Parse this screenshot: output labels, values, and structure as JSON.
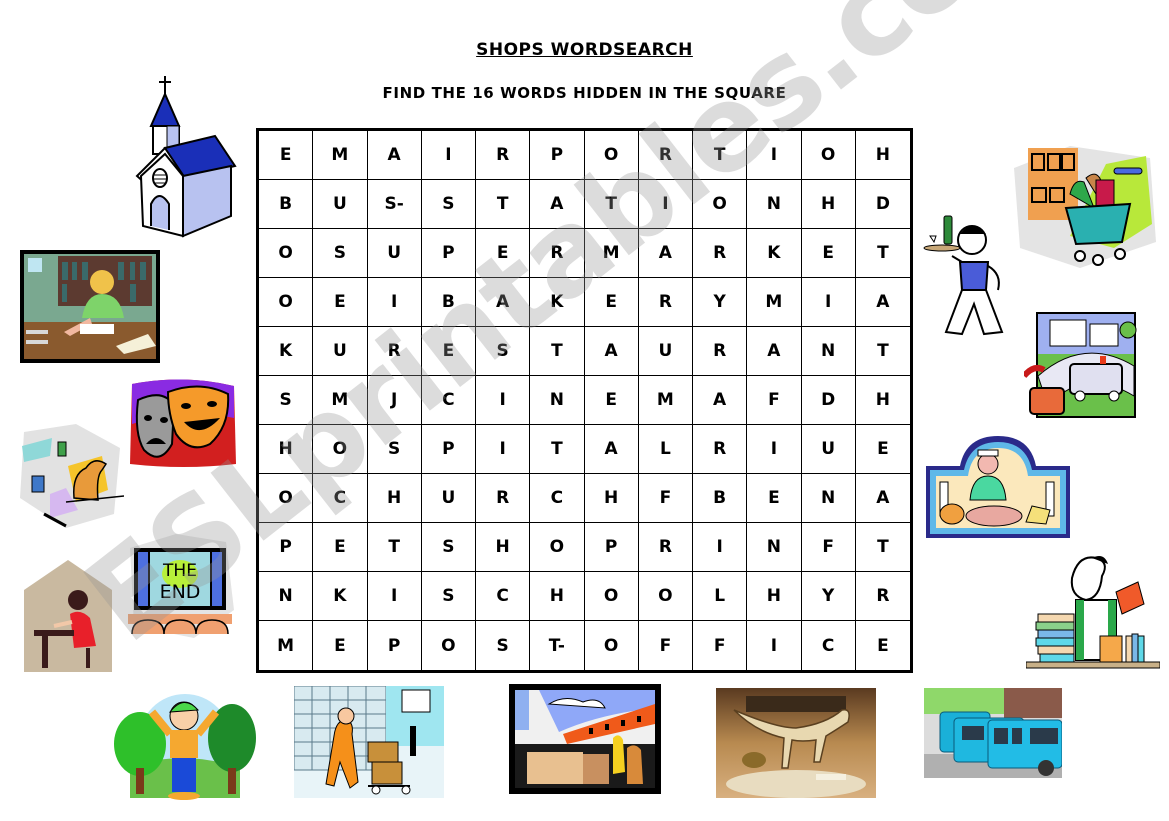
{
  "header": {
    "title": "SHOPS WORDSEARCH",
    "instructions": "FIND THE 16 WORDS HIDDEN IN THE SQUARE"
  },
  "grid": [
    [
      "E",
      "M",
      "A",
      "I",
      "R",
      "P",
      "O",
      "R",
      "T",
      "I",
      "O",
      "H"
    ],
    [
      "B",
      "U",
      "S-",
      "S",
      "T",
      "A",
      "T",
      "I",
      "O",
      "N",
      "H",
      "D"
    ],
    [
      "O",
      "S",
      "U",
      "P",
      "E",
      "R",
      "M",
      "A",
      "R",
      "K",
      "E",
      "T"
    ],
    [
      "O",
      "E",
      "I",
      "B",
      "A",
      "K",
      "E",
      "R",
      "Y",
      "M",
      "I",
      "A"
    ],
    [
      "K",
      "U",
      "R",
      "E",
      "S",
      "T",
      "A",
      "U",
      "R",
      "A",
      "N",
      "T"
    ],
    [
      "S",
      "M",
      "J",
      "C",
      "I",
      "N",
      "E",
      "M",
      "A",
      "F",
      "D",
      "H"
    ],
    [
      "H",
      "O",
      "S",
      "P",
      "I",
      "T",
      "A",
      "L",
      "R",
      "I",
      "U",
      "E"
    ],
    [
      "O",
      "C",
      "H",
      "U",
      "R",
      "C",
      "H",
      "F",
      "B",
      "E",
      "N",
      "A"
    ],
    [
      "P",
      "E",
      "T",
      "S",
      "H",
      "O",
      "P",
      "R",
      "I",
      "N",
      "F",
      "T"
    ],
    [
      "N",
      "K",
      "I",
      "S",
      "C",
      "H",
      "O",
      "O",
      "L",
      "H",
      "Y",
      "R"
    ],
    [
      "M",
      "E",
      "P",
      "O",
      "S",
      "T-",
      "O",
      "F",
      "F",
      "I",
      "C",
      "E"
    ]
  ],
  "pictures": [
    {
      "name": "church-picture",
      "label": "church"
    },
    {
      "name": "library-picture",
      "label": "library"
    },
    {
      "name": "theatre-masks-picture",
      "label": "theatre"
    },
    {
      "name": "vet-pet-shop-picture",
      "label": "pet shop"
    },
    {
      "name": "cinema-the-end-picture",
      "label": "cinema",
      "text": "THE END"
    },
    {
      "name": "school-picture",
      "label": "school"
    },
    {
      "name": "waiter-restaurant-picture",
      "label": "restaurant"
    },
    {
      "name": "supermarket-cart-picture",
      "label": "supermarket"
    },
    {
      "name": "hospital-ambulance-picture",
      "label": "hospital"
    },
    {
      "name": "bakery-picture",
      "label": "bakery"
    },
    {
      "name": "bookshop-picture",
      "label": "bookshop"
    },
    {
      "name": "park-boy-picture",
      "label": "park"
    },
    {
      "name": "post-office-picture",
      "label": "post office"
    },
    {
      "name": "airport-picture",
      "label": "airport"
    },
    {
      "name": "museum-dinosaur-picture",
      "label": "museum"
    },
    {
      "name": "bus-station-picture",
      "label": "bus station"
    }
  ],
  "watermark": "ESLprintables.com"
}
